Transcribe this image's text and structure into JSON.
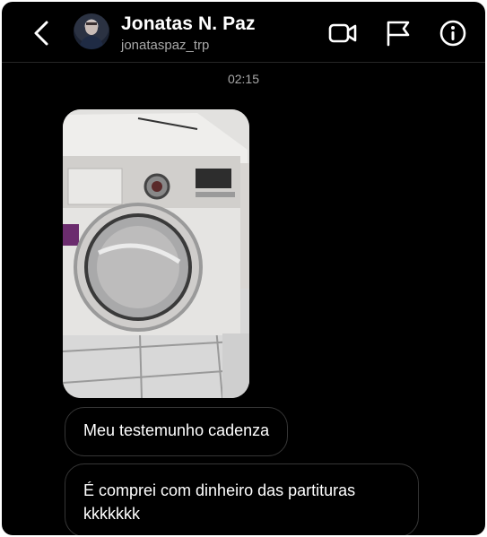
{
  "header": {
    "contact_name": "Jonatas N. Paz",
    "username": "jonataspaz_trp",
    "icons": [
      "back-arrow-icon",
      "video-call-icon",
      "flag-icon",
      "info-icon"
    ]
  },
  "conversation": {
    "timestamp": "02:15",
    "messages": [
      {
        "type": "image",
        "description_icon": "photo-of-washing-machine"
      },
      {
        "type": "text",
        "text": "Meu testemunho cadenza"
      },
      {
        "type": "text",
        "line1": "É comprei com dinheiro das partituras",
        "line2": "kkkkkkk"
      }
    ]
  },
  "colors": {
    "background": "#000000",
    "text_primary": "#ffffff",
    "text_secondary": "#a8a8a8",
    "bubble_border": "#363636"
  }
}
